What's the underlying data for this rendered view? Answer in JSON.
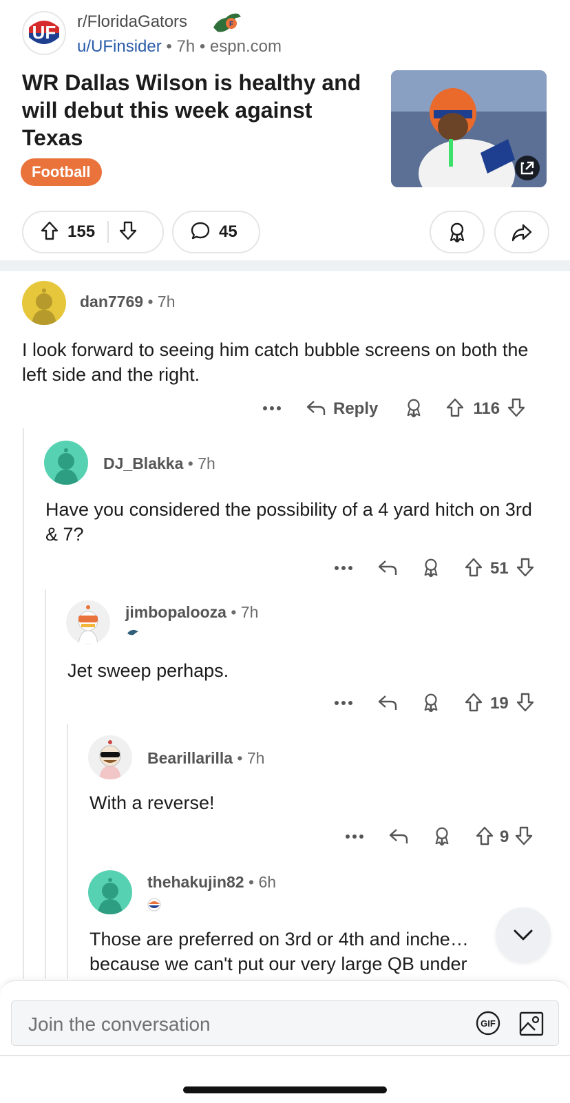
{
  "post": {
    "subreddit": "r/FloridaGators",
    "author": "u/UFinsider",
    "separator": "•",
    "age": "7h",
    "domain": "espn.com",
    "title": "WR Dallas Wilson is healthy and will debut this week against Texas",
    "flair": "Football",
    "flair_color": "#e9733b",
    "votes": "155",
    "comments": "45"
  },
  "comments": [
    {
      "user": "dan7769",
      "time": "7h",
      "body": "I look forward to seeing him catch bubble screens on both the left side and the right.",
      "reply_label": "Reply",
      "votes": "116"
    },
    {
      "user": "DJ_Blakka",
      "time": "7h",
      "body": "Have you considered the possibility of a 4 yard hitch on 3rd & 7?",
      "votes": "51"
    },
    {
      "user": "jimbopalooza",
      "time": "7h",
      "body": "Jet sweep perhaps.",
      "votes": "19"
    },
    {
      "user": "Bearillarilla",
      "time": "7h",
      "body": "With a reverse!",
      "votes": "9"
    },
    {
      "user": "thehakujin82",
      "time": "6h",
      "body": "Those are preferred on 3rd or 4th and inche… because we can't put our very large QB under"
    }
  ],
  "composer": {
    "placeholder": "Join the conversation",
    "gif_label": "GIF"
  },
  "icons": {
    "upvote": "upvote-icon",
    "downvote": "downvote-icon",
    "comment": "comment-bubble-icon",
    "award": "award-icon",
    "share": "share-icon",
    "more": "more-icon",
    "reply": "reply-icon",
    "external": "external-link-icon",
    "chevron": "chevron-down-icon",
    "image": "image-icon"
  },
  "colors": {
    "accent": "#e9733b",
    "username": "#2a5caa",
    "avatar_dan": "#e6c63a",
    "avatar_teal": "#56d1b1"
  }
}
